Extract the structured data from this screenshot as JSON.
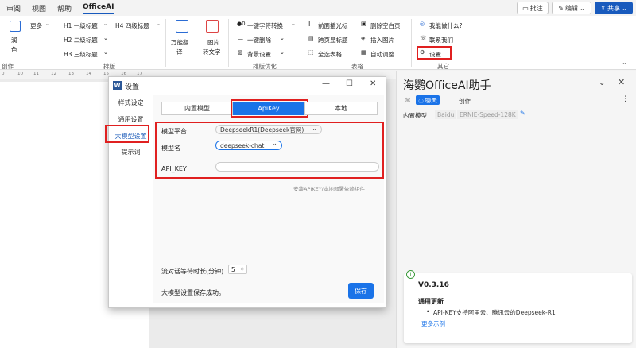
{
  "tabs": [
    "审阅",
    "视图",
    "帮助",
    "OfficeAI"
  ],
  "topbar": {
    "comment": "批注",
    "edit": "编辑",
    "share": "共享"
  },
  "ribbon": {
    "run": "润",
    "color": "色",
    "more": "更多",
    "create_label": "创作",
    "h1": "H1 一级标题",
    "h4": "H4 四级标题",
    "h2": "H2 二级标题",
    "h3": "H3 三级标题",
    "layout_label": "排版",
    "translate_line1": "万能翻",
    "translate_line2": "译",
    "pic_line1": "图片",
    "pic_line2": "转文字",
    "opt1": "一键字符转换",
    "opt2": "一键删除",
    "opt3": "背景设置",
    "opt_label": "排版优化",
    "t1": "前面插光标",
    "t2": "删除空白页",
    "t3": "跨页显标题",
    "t4": "插入图片",
    "t5": "全选表格",
    "t6": "自动调整",
    "table_label": "表格",
    "o1": "我能做什么?",
    "o2": "联系我们",
    "o3": "设置",
    "other_label": "其它"
  },
  "ruler_ticks": [
    "0",
    "10",
    "11",
    "12",
    "13",
    "14",
    "15",
    "16",
    "17"
  ],
  "dialog": {
    "title": "设置",
    "sidebar": [
      "样式设定",
      "通用设置",
      "大模型设置",
      "提示词"
    ],
    "tabs": [
      "内置模型",
      "ApiKey",
      "本地"
    ],
    "platform_label": "模型平台",
    "platform_value": "DeepseekR1(Deepseek官网)",
    "model_label": "模型名",
    "model_value": "deepseek-chat",
    "apikey_label": "API_KEY",
    "apikey_value": "",
    "hint": "安装APIKEY/本地部署依赖组件",
    "timeout_label": "流对话等待时长(分钟)",
    "timeout_value": "5",
    "status": "大模型设置保存成功。",
    "save": "保存"
  },
  "pane": {
    "title": "海鹦OfficeAI助手",
    "chat_tab": "聊天",
    "create_tab": "创作",
    "builtin_label": "内置模型",
    "provider": "Baidu",
    "model": "ERNIE-Speed-128K",
    "version": "V0.3.16",
    "update_title": "通用更新",
    "update_item": "API-KEY支持阿里云、腾讯云的Deepseek-R1",
    "more_link": "更多示例"
  }
}
